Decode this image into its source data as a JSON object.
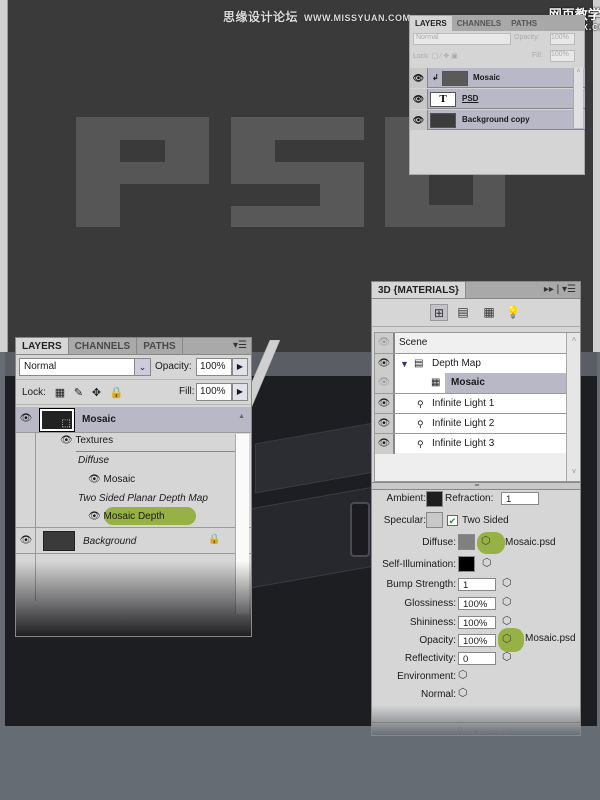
{
  "watermarks": {
    "left_cn": "思缘设计论坛",
    "left_url": "WWW.MISSYUAN.COM",
    "right_cn": "网页教学网",
    "right_url": "WWW.WEBJX.COM"
  },
  "canvas_text": "PSD",
  "small_layers_panel": {
    "tabs": [
      "LAYERS",
      "CHANNELS",
      "PATHS"
    ],
    "blend_mode": "Normal",
    "opacity_label": "Opacity:",
    "opacity_value": "100%",
    "lock_label": "Lock:",
    "fill_label": "Fill:",
    "fill_value": "100%",
    "layers": [
      {
        "name": "Mosaic"
      },
      {
        "name": "PSD",
        "type_glyph": "T"
      },
      {
        "name": "Background copy"
      }
    ]
  },
  "layers_panel": {
    "tabs": [
      "LAYERS",
      "CHANNELS",
      "PATHS"
    ],
    "blend_mode": "Normal",
    "opacity_label": "Opacity:",
    "opacity_value": "100%",
    "lock_label": "Lock:",
    "fill_label": "Fill:",
    "fill_value": "100%",
    "layers": [
      {
        "name": "Mosaic"
      },
      {
        "name": "Background"
      }
    ],
    "textures_label": "Textures",
    "diffuse_label": "Diffuse",
    "diffuse_texture": "Mosaic",
    "depth_map_label": "Two Sided Planar Depth Map",
    "depth_map_texture": "Mosaic Depth"
  },
  "panel_3d": {
    "title": "3D {MATERIALS}",
    "tree": [
      {
        "name": "Scene"
      },
      {
        "name": "Depth Map"
      },
      {
        "name": "Mosaic"
      },
      {
        "name": "Infinite Light 1"
      },
      {
        "name": "Infinite Light 2"
      },
      {
        "name": "Infinite Light 3"
      }
    ],
    "properties": {
      "ambient": {
        "label": "Ambient:",
        "color": "#1e1e1e"
      },
      "refraction": {
        "label": "Refraction:",
        "value": "1"
      },
      "specular": {
        "label": "Specular:",
        "color": "#c8c8c8"
      },
      "two_sided": {
        "label": "Two Sided",
        "checked": true
      },
      "diffuse": {
        "label": "Diffuse:",
        "color": "#808080",
        "texture": "Mosaic.psd"
      },
      "self_illumination": {
        "label": "Self-Illumination:",
        "color": "#000000"
      },
      "bump_strength": {
        "label": "Bump Strength:",
        "value": "1"
      },
      "glossiness": {
        "label": "Glossiness:",
        "value": "100%"
      },
      "shininess": {
        "label": "Shininess:",
        "value": "100%"
      },
      "opacity": {
        "label": "Opacity:",
        "value": "100%",
        "texture": "Mosaic.psd"
      },
      "reflectivity": {
        "label": "Reflectivity:",
        "value": "0"
      },
      "environment": {
        "label": "Environment:"
      },
      "normal": {
        "label": "Normal:"
      }
    }
  },
  "colors": {
    "highlight_green": "#93b03c",
    "selected_row": "#b8b8c6"
  }
}
